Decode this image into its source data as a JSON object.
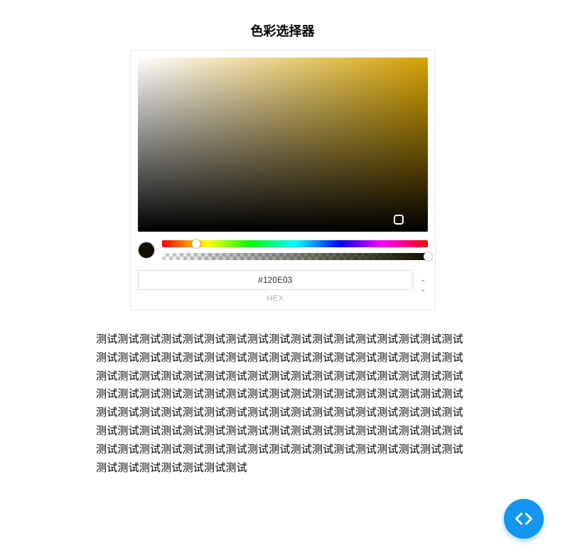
{
  "title": "色彩选择器",
  "picker": {
    "hex_value": "#120E03",
    "mode_label": "HEX",
    "swatch_color": "#120E03"
  },
  "paragraph_text": "测试测试测试测试测试测试测试测试测试测试测试测试测试测试测试测试测试测试测试测试测试测试测试测试测试测试测试测试测试测试测试测试测试测试测试测试测试测试测试测试测试测试测试测试测试测试测试测试测试测试测试测试测试测试测试测试测试测试测试测试测试测试测试测试测试测试测试测试测试测试测试测试测试测试测试测试测试测试测试测试测试测试测试测试测试测试测试测试测试测试测试测试测试测试测试测试测试测试测试测试测试测试测试测试测试测试测试测试测试测试测试测试测试测试测试测试测试测试测试测试测试测试测试测试测试测试"
}
